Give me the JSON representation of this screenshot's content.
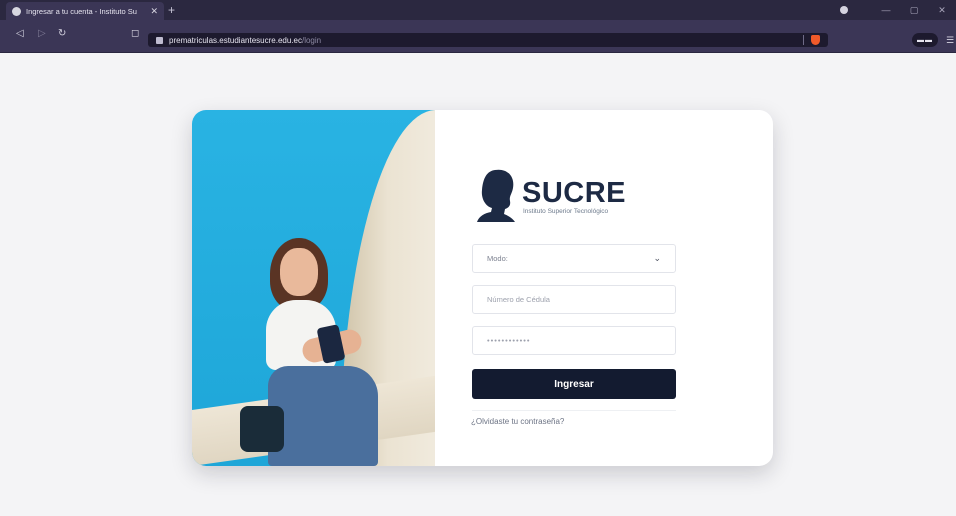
{
  "browser": {
    "tab_title": "Ingresar a tu cuenta - Instituto Su",
    "tab_close": "✕",
    "new_tab": "+",
    "url_host": "prematriculas.estudiantesucre.edu.ec",
    "url_path": "/login",
    "ext_label": "▬▬",
    "menu": "☰"
  },
  "logo": {
    "word": "SUCRE",
    "subtitle": "Instituto Superior Tecnológico"
  },
  "form": {
    "mode_selected": "Modo:",
    "chevron": "⌄",
    "cedula_placeholder": "Número de Cédula",
    "password_value": "••••••••••••",
    "submit_label": "Ingresar",
    "forgot_label": "¿Olvidaste tu contraseña?"
  },
  "colors": {
    "brand_navy": "#131b30",
    "photo_blue": "#1ea6d8",
    "browser_purple": "#3b3656"
  }
}
